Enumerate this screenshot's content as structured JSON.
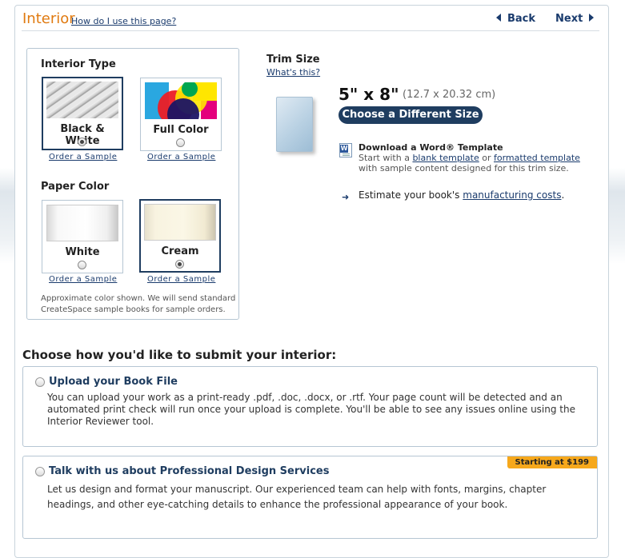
{
  "header": {
    "title": "Interior",
    "help_link": "How do I use this page?",
    "back_label": "Back",
    "next_label": "Next"
  },
  "interior_type": {
    "heading": "Interior Type",
    "options": [
      {
        "label": "Black & White",
        "selected": true,
        "sample_link": "Order a Sample"
      },
      {
        "label": "Full Color",
        "selected": false,
        "sample_link": "Order a Sample"
      }
    ]
  },
  "paper_color": {
    "heading": "Paper Color",
    "options": [
      {
        "label": "White",
        "selected": false,
        "sample_link": "Order a Sample"
      },
      {
        "label": "Cream",
        "selected": true,
        "sample_link": "Order a Sample"
      }
    ],
    "note": "Approximate color shown. We will send standard CreateSpace sample books for sample orders."
  },
  "trim": {
    "heading": "Trim Size",
    "whats_this": "What's this?",
    "size": "5\" x 8\"",
    "size_metric": "(12.7 x 20.32 cm)",
    "change_button": "Choose a Different Size"
  },
  "template": {
    "heading": "Download a Word® Template",
    "text_prefix": "Start with a",
    "blank_link": "blank template",
    "or": "or",
    "formatted_link": "formatted template",
    "text_suffix": "with sample content designed for this trim size."
  },
  "estimate": {
    "prefix": "Estimate your book's",
    "link": "manufacturing costs",
    "suffix": "."
  },
  "submit": {
    "heading": "Choose how you'd like to submit your interior:",
    "options": [
      {
        "title": "Upload your Book File",
        "body": "You can upload your work as a print-ready .pdf, .doc, .docx, or .rtf. Your page count will be detected and an automated print check will run once your upload is complete. You'll be able to see any issues online using the Interior Reviewer tool."
      },
      {
        "title": "Talk with us about Professional Design Services",
        "badge": "Starting at $199",
        "body": "Let us design and format your manuscript. Our experienced team can help with fonts, margins, chapter headings, and other eye-catching details to enhance the professional appearance of your book."
      }
    ]
  },
  "colors": {
    "accent_orange": "#e07a10",
    "navy": "#1f3d60",
    "link": "#1a3b6d",
    "badge": "#f6a81c"
  }
}
